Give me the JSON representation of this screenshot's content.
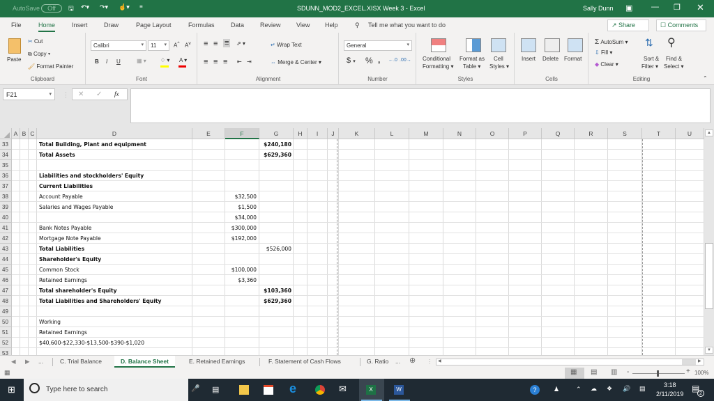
{
  "titlebar": {
    "autosave_label": "AutoSave",
    "autosave_state": "Off",
    "file_title": "SDUNN_MOD2_EXCEL.XISX Week 3  -  Excel",
    "user_name": "Sally Dunn"
  },
  "ribbon_tabs": [
    "File",
    "Home",
    "Insert",
    "Draw",
    "Page Layout",
    "Formulas",
    "Data",
    "Review",
    "View",
    "Help"
  ],
  "active_tab": "Home",
  "tell_me": "Tell me what you want to do",
  "share_label": "Share",
  "comments_label": "Comments",
  "ribbon": {
    "clipboard": {
      "paste": "Paste",
      "cut": "Cut",
      "copy": "Copy",
      "format_painter": "Format Painter",
      "label": "Clipboard"
    },
    "font": {
      "font_name": "Calibri",
      "font_size": "11",
      "bold": "B",
      "italic": "I",
      "underline": "U",
      "label": "Font",
      "fill_color": "#ffff00",
      "font_color": "#ff0000"
    },
    "alignment": {
      "wrap_text": "Wrap Text",
      "merge_center": "Merge & Center",
      "label": "Alignment"
    },
    "number": {
      "format": "General",
      "currency": "$",
      "percent": "%",
      "comma": ",",
      "label": "Number"
    },
    "styles": {
      "conditional": "Conditional",
      "formatting": "Formatting",
      "format_as": "Format as",
      "table": "Table",
      "cell": "Cell",
      "styles": "Styles",
      "label": "Styles"
    },
    "cells": {
      "insert": "Insert",
      "delete": "Delete",
      "format": "Format",
      "label": "Cells"
    },
    "editing": {
      "autosum": "AutoSum",
      "fill": "Fill",
      "clear": "Clear",
      "sort": "Sort &",
      "filter": "Filter",
      "find": "Find &",
      "select": "Select",
      "label": "Editing"
    }
  },
  "formula_bar": {
    "name_box": "F21",
    "formula": "",
    "fx": "fx"
  },
  "columns": [
    "A",
    "B",
    "C",
    "D",
    "E",
    "F",
    "G",
    "H",
    "I",
    "J",
    "K",
    "L",
    "M",
    "N",
    "O",
    "P",
    "Q",
    "R",
    "S",
    "T",
    "U"
  ],
  "selected_column": "F",
  "rows": [
    {
      "n": "33",
      "d": "Total Building, Plant and equipment",
      "d_bold": true,
      "f": "",
      "g": "$240,180",
      "g_bold": true
    },
    {
      "n": "34",
      "d": "Total Assets",
      "d_bold": true,
      "f": "",
      "g": "$629,360",
      "g_bold": true
    },
    {
      "n": "35",
      "d": "",
      "f": "",
      "g": ""
    },
    {
      "n": "36",
      "d": "Liabilities and stockholders' Equity",
      "d_bold": true,
      "f": "",
      "g": ""
    },
    {
      "n": "37",
      "d": "Current Liabilities",
      "d_bold": true,
      "f": "",
      "g": ""
    },
    {
      "n": "38",
      "d": "Account Payable",
      "f": "$32,500",
      "g": ""
    },
    {
      "n": "39",
      "d": "Salaries and Wages Payable",
      "f": "$1,500",
      "g": ""
    },
    {
      "n": "40",
      "d": "",
      "f": "$34,000",
      "g": ""
    },
    {
      "n": "41",
      "d": "Bank Notes Payable",
      "f": "$300,000",
      "g": ""
    },
    {
      "n": "42",
      "d": "Mortgage Note Payable",
      "f": "$192,000",
      "g": ""
    },
    {
      "n": "43",
      "d": "Total Liabilities",
      "d_bold": true,
      "f": "",
      "g": "$526,000"
    },
    {
      "n": "44",
      "d": "Shareholder's Equity",
      "d_bold": true,
      "f": "",
      "g": ""
    },
    {
      "n": "45",
      "d": "Common Stock",
      "f": "$100,000",
      "g": ""
    },
    {
      "n": "46",
      "d": "Retained Earnings",
      "f": "$3,360",
      "g": ""
    },
    {
      "n": "47",
      "d": "Total shareholder's Equity",
      "d_bold": true,
      "f": "",
      "g": "$103,360",
      "g_bold": true
    },
    {
      "n": "48",
      "d": "Total Liabilities and Shareholders' Equity",
      "d_bold": true,
      "f": "",
      "g": "$629,360",
      "g_bold": true
    },
    {
      "n": "49",
      "d": "",
      "f": "",
      "g": ""
    },
    {
      "n": "50",
      "d": "Working",
      "f": "",
      "g": ""
    },
    {
      "n": "51",
      "d": "Retained Earnings",
      "f": "",
      "g": ""
    },
    {
      "n": "52",
      "d": "$40,600-$22,330-$13,500-$390-$1,020",
      "f": "",
      "g": ""
    },
    {
      "n": "53",
      "d": "",
      "f": "",
      "g": ""
    }
  ],
  "sheet_tabs": [
    "C. Trial Balance",
    "D. Balance Sheet",
    "E. Retained Earnings",
    "F. Statement of Cash Flows",
    "G. Ratio"
  ],
  "active_sheet": "D. Balance Sheet",
  "more": "...",
  "zoom_level": "100%",
  "taskbar": {
    "search_placeholder": "Type here to search",
    "time": "3:18",
    "date": "2/11/2019",
    "notifications": "2"
  }
}
